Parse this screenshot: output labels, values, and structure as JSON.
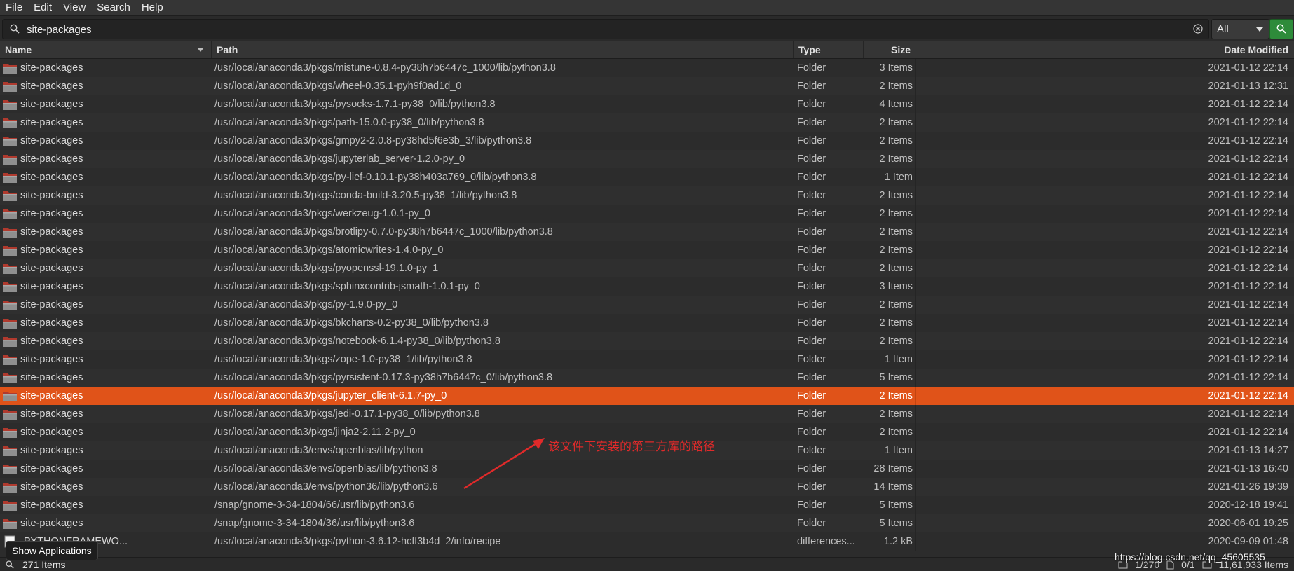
{
  "menu": [
    "File",
    "Edit",
    "View",
    "Search",
    "Help"
  ],
  "search": {
    "value": "site-packages",
    "scope": "All"
  },
  "columns": {
    "name": "Name",
    "path": "Path",
    "type": "Type",
    "size": "Size",
    "date": "Date Modified"
  },
  "rows": [
    {
      "name": "site-packages",
      "path": "/usr/local/anaconda3/pkgs/mistune-0.8.4-py38h7b6447c_1000/lib/python3.8",
      "type": "Folder",
      "size": "3 Items",
      "date": "2021-01-12 22:14"
    },
    {
      "name": "site-packages",
      "path": "/usr/local/anaconda3/pkgs/wheel-0.35.1-pyh9f0ad1d_0",
      "type": "Folder",
      "size": "2 Items",
      "date": "2021-01-13 12:31"
    },
    {
      "name": "site-packages",
      "path": "/usr/local/anaconda3/pkgs/pysocks-1.7.1-py38_0/lib/python3.8",
      "type": "Folder",
      "size": "4 Items",
      "date": "2021-01-12 22:14"
    },
    {
      "name": "site-packages",
      "path": "/usr/local/anaconda3/pkgs/path-15.0.0-py38_0/lib/python3.8",
      "type": "Folder",
      "size": "2 Items",
      "date": "2021-01-12 22:14"
    },
    {
      "name": "site-packages",
      "path": "/usr/local/anaconda3/pkgs/gmpy2-2.0.8-py38hd5f6e3b_3/lib/python3.8",
      "type": "Folder",
      "size": "2 Items",
      "date": "2021-01-12 22:14"
    },
    {
      "name": "site-packages",
      "path": "/usr/local/anaconda3/pkgs/jupyterlab_server-1.2.0-py_0",
      "type": "Folder",
      "size": "2 Items",
      "date": "2021-01-12 22:14"
    },
    {
      "name": "site-packages",
      "path": "/usr/local/anaconda3/pkgs/py-lief-0.10.1-py38h403a769_0/lib/python3.8",
      "type": "Folder",
      "size": "1 Item",
      "date": "2021-01-12 22:14"
    },
    {
      "name": "site-packages",
      "path": "/usr/local/anaconda3/pkgs/conda-build-3.20.5-py38_1/lib/python3.8",
      "type": "Folder",
      "size": "2 Items",
      "date": "2021-01-12 22:14"
    },
    {
      "name": "site-packages",
      "path": "/usr/local/anaconda3/pkgs/werkzeug-1.0.1-py_0",
      "type": "Folder",
      "size": "2 Items",
      "date": "2021-01-12 22:14"
    },
    {
      "name": "site-packages",
      "path": "/usr/local/anaconda3/pkgs/brotlipy-0.7.0-py38h7b6447c_1000/lib/python3.8",
      "type": "Folder",
      "size": "2 Items",
      "date": "2021-01-12 22:14"
    },
    {
      "name": "site-packages",
      "path": "/usr/local/anaconda3/pkgs/atomicwrites-1.4.0-py_0",
      "type": "Folder",
      "size": "2 Items",
      "date": "2021-01-12 22:14"
    },
    {
      "name": "site-packages",
      "path": "/usr/local/anaconda3/pkgs/pyopenssl-19.1.0-py_1",
      "type": "Folder",
      "size": "2 Items",
      "date": "2021-01-12 22:14"
    },
    {
      "name": "site-packages",
      "path": "/usr/local/anaconda3/pkgs/sphinxcontrib-jsmath-1.0.1-py_0",
      "type": "Folder",
      "size": "3 Items",
      "date": "2021-01-12 22:14"
    },
    {
      "name": "site-packages",
      "path": "/usr/local/anaconda3/pkgs/py-1.9.0-py_0",
      "type": "Folder",
      "size": "2 Items",
      "date": "2021-01-12 22:14"
    },
    {
      "name": "site-packages",
      "path": "/usr/local/anaconda3/pkgs/bkcharts-0.2-py38_0/lib/python3.8",
      "type": "Folder",
      "size": "2 Items",
      "date": "2021-01-12 22:14"
    },
    {
      "name": "site-packages",
      "path": "/usr/local/anaconda3/pkgs/notebook-6.1.4-py38_0/lib/python3.8",
      "type": "Folder",
      "size": "2 Items",
      "date": "2021-01-12 22:14"
    },
    {
      "name": "site-packages",
      "path": "/usr/local/anaconda3/pkgs/zope-1.0-py38_1/lib/python3.8",
      "type": "Folder",
      "size": "1 Item",
      "date": "2021-01-12 22:14"
    },
    {
      "name": "site-packages",
      "path": "/usr/local/anaconda3/pkgs/pyrsistent-0.17.3-py38h7b6447c_0/lib/python3.8",
      "type": "Folder",
      "size": "5 Items",
      "date": "2021-01-12 22:14"
    },
    {
      "name": "site-packages",
      "path": "/usr/local/anaconda3/pkgs/jupyter_client-6.1.7-py_0",
      "type": "Folder",
      "size": "2 Items",
      "date": "2021-01-12 22:14",
      "selected": true
    },
    {
      "name": "site-packages",
      "path": "/usr/local/anaconda3/pkgs/jedi-0.17.1-py38_0/lib/python3.8",
      "type": "Folder",
      "size": "2 Items",
      "date": "2021-01-12 22:14"
    },
    {
      "name": "site-packages",
      "path": "/usr/local/anaconda3/pkgs/jinja2-2.11.2-py_0",
      "type": "Folder",
      "size": "2 Items",
      "date": "2021-01-12 22:14"
    },
    {
      "name": "site-packages",
      "path": "/usr/local/anaconda3/envs/openblas/lib/python",
      "type": "Folder",
      "size": "1 Item",
      "date": "2021-01-13 14:27"
    },
    {
      "name": "site-packages",
      "path": "/usr/local/anaconda3/envs/openblas/lib/python3.8",
      "type": "Folder",
      "size": "28 Items",
      "date": "2021-01-13 16:40"
    },
    {
      "name": "site-packages",
      "path": "/usr/local/anaconda3/envs/python36/lib/python3.6",
      "type": "Folder",
      "size": "14 Items",
      "date": "2021-01-26 19:39"
    },
    {
      "name": "site-packages",
      "path": "/snap/gnome-3-34-1804/66/usr/lib/python3.6",
      "type": "Folder",
      "size": "5 Items",
      "date": "2020-12-18 19:41"
    },
    {
      "name": "site-packages",
      "path": "/snap/gnome-3-34-1804/36/usr/lib/python3.6",
      "type": "Folder",
      "size": "5 Items",
      "date": "2020-06-01 19:25"
    },
    {
      "name": "-PYTHONFRAMEWO...",
      "path": "/usr/local/anaconda3/pkgs/python-3.6.12-hcff3b4d_2/info/recipe",
      "type": "differences...",
      "size": "1.2 kB",
      "date": "2020-09-09 01:48",
      "file": true
    }
  ],
  "annotation": "该文件下安装的第三方库的路径",
  "tooltip": "Show Applications",
  "status": {
    "count": "271 Items",
    "folders": "1/270",
    "files": "0/1",
    "total": "11,61,933 Items"
  },
  "watermark": "https://blog.csdn.net/qq_45605535",
  "colors": {
    "selection": "#e05319",
    "folder": "#b03a2e",
    "search_button": "#2e8b3a",
    "annotation": "#e02a2a"
  },
  "icons": {
    "search": "search-icon",
    "clear": "clear-icon",
    "folder": "folder-icon"
  }
}
